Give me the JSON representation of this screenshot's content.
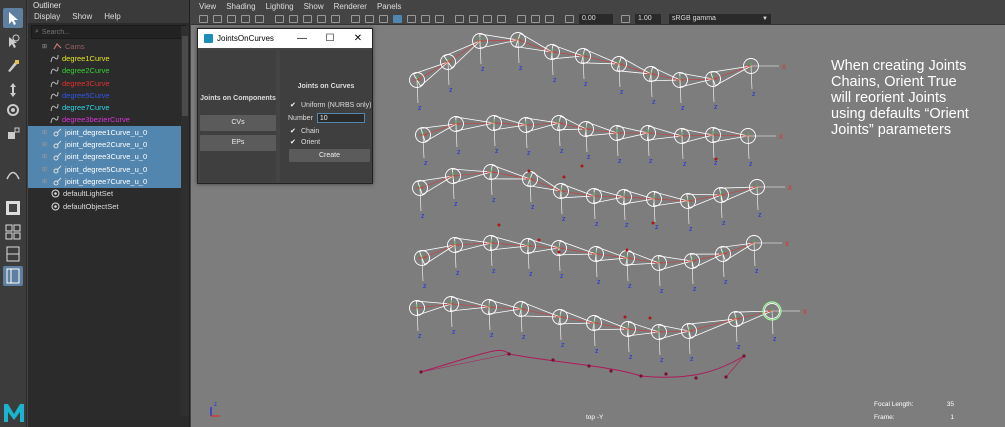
{
  "outliner": {
    "title": "Outliner",
    "menu": [
      "Display",
      "Show",
      "Help"
    ],
    "search_placeholder": "Search...",
    "items": [
      {
        "label": "Cams",
        "color": "#9a6060",
        "icon": "camera-group-icon",
        "type": "group",
        "selected": false
      },
      {
        "label": "degree1Curve",
        "color": "#e6e61e",
        "icon": "curve-icon",
        "type": "child",
        "selected": false
      },
      {
        "label": "degree2Curve",
        "color": "#33d333",
        "icon": "curve-icon",
        "type": "child",
        "selected": false
      },
      {
        "label": "degree3Curve",
        "color": "#e23030",
        "icon": "curve-icon",
        "type": "child",
        "selected": false
      },
      {
        "label": "degree5Curve",
        "color": "#2f58e8",
        "icon": "curve-icon",
        "type": "child",
        "selected": false
      },
      {
        "label": "degree7Curve",
        "color": "#29d7e8",
        "icon": "curve-icon",
        "type": "child",
        "selected": false
      },
      {
        "label": "degree3bezierCurve",
        "color": "#d834d8",
        "icon": "curve-icon",
        "type": "child",
        "selected": false
      },
      {
        "label": "joint_degree1Curve_u_0",
        "color": "#ffffff",
        "icon": "joint-icon",
        "type": "group",
        "selected": true
      },
      {
        "label": "joint_degree2Curve_u_0",
        "color": "#ffffff",
        "icon": "joint-icon",
        "type": "group",
        "selected": true
      },
      {
        "label": "joint_degree3Curve_u_0",
        "color": "#ffffff",
        "icon": "joint-icon",
        "type": "group",
        "selected": true
      },
      {
        "label": "joint_degree5Curve_u_0",
        "color": "#ffffff",
        "icon": "joint-icon",
        "type": "group",
        "selected": true
      },
      {
        "label": "joint_degree7Curve_u_0",
        "color": "#ffffff",
        "icon": "joint-icon",
        "type": "group",
        "selected": true
      },
      {
        "label": "defaultLightSet",
        "color": "#dddddd",
        "icon": "set-icon",
        "type": "plain",
        "selected": false
      },
      {
        "label": "defaultObjectSet",
        "color": "#dddddd",
        "icon": "set-icon",
        "type": "plain",
        "selected": false
      }
    ]
  },
  "viewport": {
    "menu": [
      "View",
      "Shading",
      "Lighting",
      "Show",
      "Renderer",
      "Panels"
    ],
    "exposure": "0.00",
    "gamma": "1.00",
    "color_space": "sRGB gamma",
    "camera": "top -Y",
    "annotation": "When creating Joints\nChains, Orient True\nwill reorient Joints\nusing defaults “Orient\nJoints” parameters",
    "hud": {
      "focal_label": "Focal Length:",
      "focal_value": "35",
      "frame_label": "Frame:",
      "frame_value": "1"
    },
    "axis_label": "z",
    "joint_z_label": "z",
    "joint_x_label": "x"
  },
  "joints_window": {
    "title": "JointsOnCurves",
    "left_header": "Joints on Components",
    "cvs_label": "CVs",
    "eps_label": "EPs",
    "right_header": "Joints on Curves",
    "uniform_label": "Uniform (NURBS only)",
    "uniform_checked": true,
    "number_label": "Number",
    "number_value": "10",
    "chain_label": "Chain",
    "chain_checked": true,
    "orient_label": "Orient",
    "orient_checked": true,
    "create_label": "Create",
    "min_glyph": "—",
    "max_glyph": "☐",
    "close_glyph": "✕"
  },
  "colors": {
    "selection": "#5386ae",
    "viewport_bg": "#7d7d7d",
    "joint": "#ffffff",
    "axis_x": "#e03030",
    "axis_z": "#2030e0",
    "bezier": "#b0185a"
  }
}
